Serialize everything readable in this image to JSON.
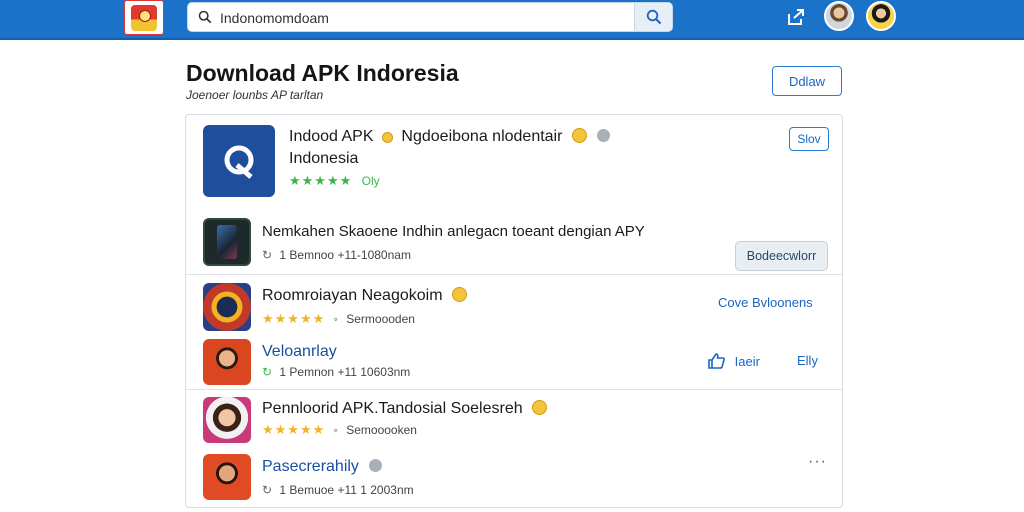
{
  "search": {
    "value": "Indonomomdoam"
  },
  "page": {
    "title": "Download APK Indoresia",
    "subtitle": "Joenoer lounbs AP tarltan",
    "header_button": "Ddlaw"
  },
  "rows": [
    {
      "title_line1": "Indood APK",
      "title_line1b": "Ngdoeibona nlodentair",
      "title_line2": "Indonesia",
      "stars": "★★★★★",
      "rating_label": "Oly",
      "button": "Slov"
    },
    {
      "title": "Nemkahen Skaoene Indhin anlegacn toeant dengian APY",
      "meta": "1 Bemnoo  +11-1080nam",
      "button": "Bodeecwlorr"
    },
    {
      "title": "Roomroiayan Neagokoim",
      "stars": "★★★★★",
      "meta": "Sermoooden",
      "action": "Cove Bvloonens"
    },
    {
      "title": "Veloanrlay",
      "meta": "1 Pemnon  +11 10603nm",
      "action1": "Iaeir",
      "action2": "Elly"
    },
    {
      "title": "Pennloorid APK.Tandosial Soelesreh",
      "stars": "★★★★★",
      "meta": "Semooooken"
    },
    {
      "title": "Pasecrerahily",
      "meta": "1 Bemuoe  +11 1 2003nm",
      "more": "···"
    }
  ],
  "colors": {
    "topbar": "#1a73c9",
    "accent": "#2a7bd6",
    "link": "#1a4fa0",
    "stars_green": "#3bb54a",
    "stars_gold": "#f0b321"
  },
  "icons": [
    "app-logo-icon",
    "search-icon",
    "share-icon",
    "avatar",
    "app-icon",
    "refresh-icon",
    "thumbs-up-icon",
    "more-icon"
  ]
}
